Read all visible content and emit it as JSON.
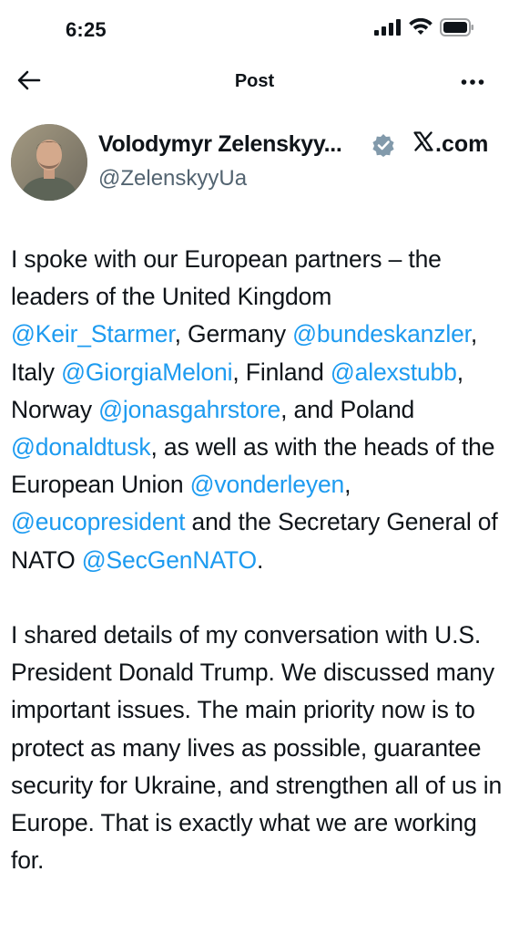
{
  "status_bar": {
    "time": "6:25"
  },
  "nav": {
    "title": "Post"
  },
  "author": {
    "name": "Volodymyr Zelenskyy...",
    "handle": "@ZelenskyyUa",
    "source": ".com",
    "verified": true,
    "badge_color": "#829aab"
  },
  "post": {
    "p1": {
      "t0": "I spoke with our European partners – the leaders of the United Kingdom ",
      "m0": "@Keir_Starmer",
      "t1": ", Germany ",
      "m1": "@bundeskanzler",
      "t2": ", Italy ",
      "m2": "@GiorgiaMeloni",
      "t3": ", Finland ",
      "m3": "@alexstubb",
      "t4": ", Norway ",
      "m4": "@jonasgahrstore",
      "t5": ", and Poland ",
      "m5": "@donaldtusk",
      "t6": ", as well as with the heads of the European Union ",
      "m6": "@vonderleyen",
      "t7": ", ",
      "m7": "@eucopresident",
      "t8": " and the Secretary General of NATO ",
      "m8": "@SecGenNATO",
      "t9": "."
    },
    "p2": {
      "text": "I shared details of my conversation with U.S. President Donald Trump. We discussed many important issues. The main priority now is to protect as many lives as possible, guarantee security for Ukraine, and strengthen all of us in Europe. That is exactly what we are working for."
    }
  },
  "colors": {
    "link": "#1d9bf0",
    "text": "#0f1419",
    "secondary": "#536471"
  }
}
